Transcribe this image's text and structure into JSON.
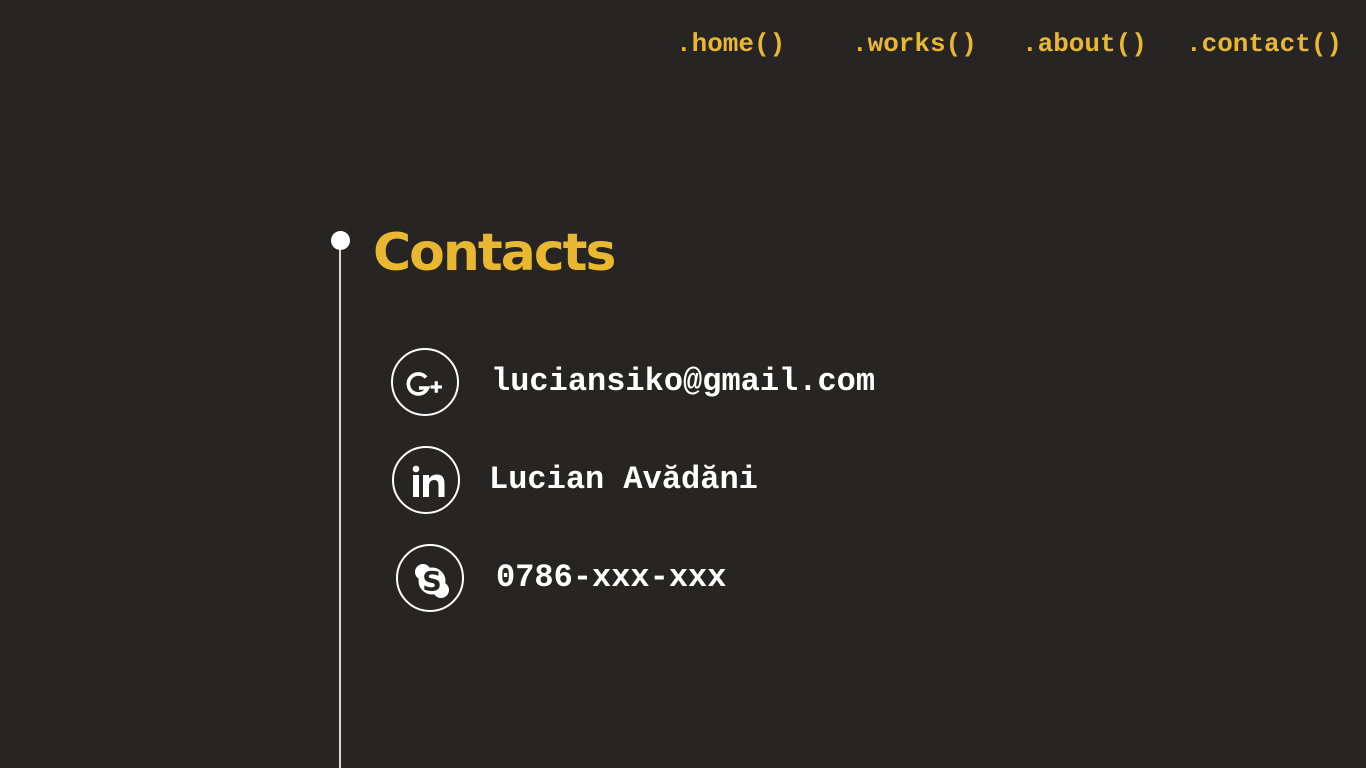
{
  "nav": {
    "home": ".home()",
    "works": ".works()",
    "about": ".about()",
    "contact": ".contact()"
  },
  "contacts": {
    "title": "Contacts",
    "items": [
      {
        "icon": "google-plus-icon",
        "text": "luciansiko@gmail.com"
      },
      {
        "icon": "linkedin-icon",
        "text": "Lucian Avădăni"
      },
      {
        "icon": "skype-icon",
        "text": "0786-xxx-xxx"
      }
    ]
  },
  "colors": {
    "background": "#262524",
    "accent": "#e9b830",
    "text": "#ffffff",
    "timeline": "#d8d8d8"
  }
}
